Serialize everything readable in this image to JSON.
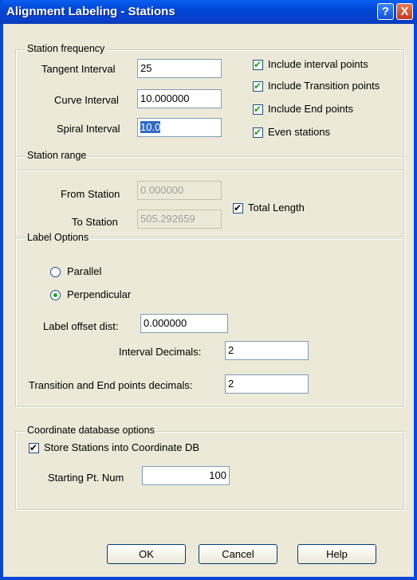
{
  "window": {
    "title": "Alignment Labeling - Stations",
    "help_glyph": "?",
    "close_glyph": "X"
  },
  "station_frequency": {
    "group_label": "Station frequency",
    "tangent_label": "Tangent Interval",
    "tangent_value": "25",
    "curve_label": "Curve Interval",
    "curve_value": "10.000000",
    "spiral_label": "Spiral Interval",
    "spiral_value": "10.0",
    "include_interval": "Include interval points",
    "include_transition": "Include Transition points",
    "include_end": "Include End points",
    "even_stations": "Even stations"
  },
  "station_range": {
    "group_label": "Station range",
    "from_label": "From Station",
    "from_value": "0.000000",
    "to_label": "To Station",
    "to_value": "505.292659",
    "total_length": "Total Length"
  },
  "label_options": {
    "group_label": "Label Options",
    "parallel": "Parallel",
    "perpendicular": "Perpendicular",
    "offset_label": "Label offset dist:",
    "offset_value": "0.000000",
    "interval_dec_label": "Interval Decimals:",
    "interval_dec_value": "2",
    "trans_dec_label": "Transition and End points decimals:",
    "trans_dec_value": "2"
  },
  "coord_db": {
    "group_label": "Coordinate database options",
    "store": "Store Stations into Coordinate DB",
    "start_label": "Starting Pt. Num",
    "start_value": "100"
  },
  "buttons": {
    "ok": "OK",
    "cancel": "Cancel",
    "help": "Help"
  }
}
